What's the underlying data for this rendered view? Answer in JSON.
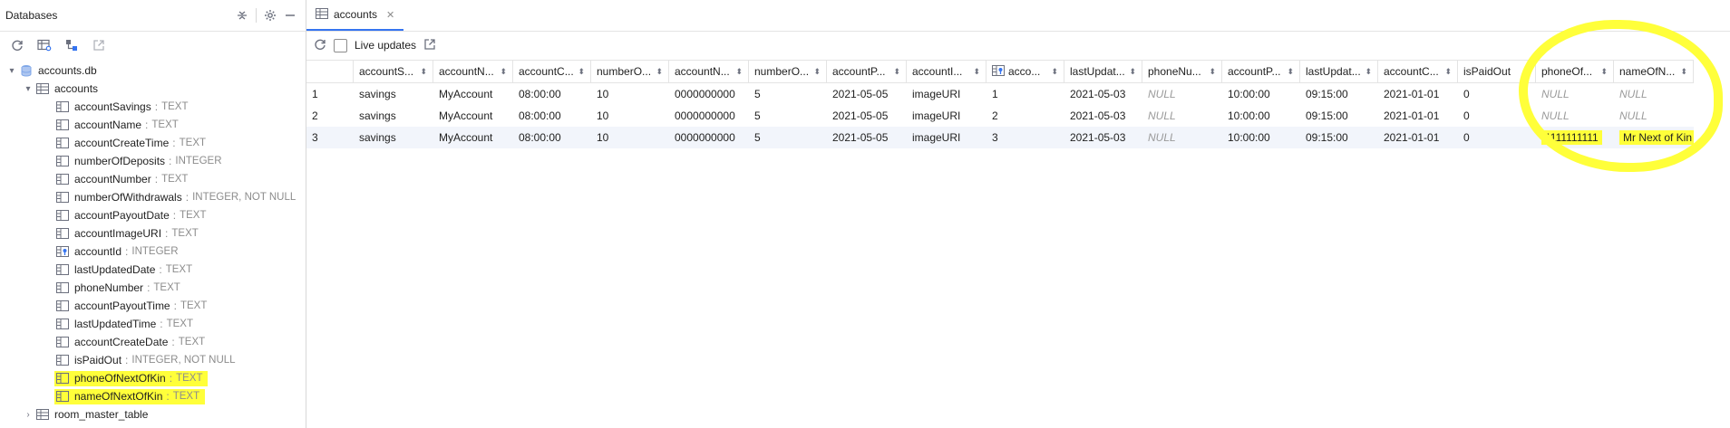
{
  "left": {
    "title": "Databases",
    "db_name": "accounts.db",
    "table_name": "accounts",
    "columns": [
      {
        "name": "accountSavings",
        "type": "TEXT"
      },
      {
        "name": "accountName",
        "type": "TEXT"
      },
      {
        "name": "accountCreateTime",
        "type": "TEXT"
      },
      {
        "name": "numberOfDeposits",
        "type": "INTEGER"
      },
      {
        "name": "accountNumber",
        "type": "TEXT"
      },
      {
        "name": "numberOfWithdrawals",
        "type": "INTEGER, NOT NULL"
      },
      {
        "name": "accountPayoutDate",
        "type": "TEXT"
      },
      {
        "name": "accountImageURI",
        "type": "TEXT"
      },
      {
        "name": "accountId",
        "type": "INTEGER"
      },
      {
        "name": "lastUpdatedDate",
        "type": "TEXT"
      },
      {
        "name": "phoneNumber",
        "type": "TEXT"
      },
      {
        "name": "accountPayoutTime",
        "type": "TEXT"
      },
      {
        "name": "lastUpdatedTime",
        "type": "TEXT"
      },
      {
        "name": "accountCreateDate",
        "type": "TEXT"
      },
      {
        "name": "isPaidOut",
        "type": "INTEGER, NOT NULL"
      },
      {
        "name": "phoneOfNextOfKin",
        "type": "TEXT"
      },
      {
        "name": "nameOfNextOfKin",
        "type": "TEXT"
      }
    ],
    "other_table": "room_master_table",
    "separator": ":"
  },
  "right": {
    "tab_label": "accounts",
    "live_updates": "Live updates",
    "headers": [
      "accountS...",
      "accountN...",
      "accountC...",
      "numberO...",
      "accountN...",
      "numberO...",
      "accountP...",
      "accountI...",
      "acco...",
      "lastUpdat...",
      "phoneNu...",
      "accountP...",
      "lastUpdat...",
      "accountC...",
      "isPaidOut",
      "phoneOf...",
      "nameOfN..."
    ],
    "rows": [
      {
        "num": "1",
        "cells": [
          "savings",
          "MyAccount",
          "08:00:00",
          "10",
          "0000000000",
          "5",
          "2021-05-05",
          "imageURI",
          "1",
          "2021-05-03",
          "NULL",
          "10:00:00",
          "09:15:00",
          "2021-01-01",
          "0",
          "NULL",
          "NULL"
        ]
      },
      {
        "num": "2",
        "cells": [
          "savings",
          "MyAccount",
          "08:00:00",
          "10",
          "0000000000",
          "5",
          "2021-05-05",
          "imageURI",
          "2",
          "2021-05-03",
          "NULL",
          "10:00:00",
          "09:15:00",
          "2021-01-01",
          "0",
          "NULL",
          "NULL"
        ]
      },
      {
        "num": "3",
        "cells": [
          "savings",
          "MyAccount",
          "08:00:00",
          "10",
          "0000000000",
          "5",
          "2021-05-05",
          "imageURI",
          "3",
          "2021-05-03",
          "NULL",
          "10:00:00",
          "09:15:00",
          "2021-01-01",
          "0",
          "1111111111",
          "Mr Next of Kin"
        ]
      }
    ]
  },
  "colors": {
    "highlight": "#ffff3a",
    "accent": "#3574f0"
  }
}
